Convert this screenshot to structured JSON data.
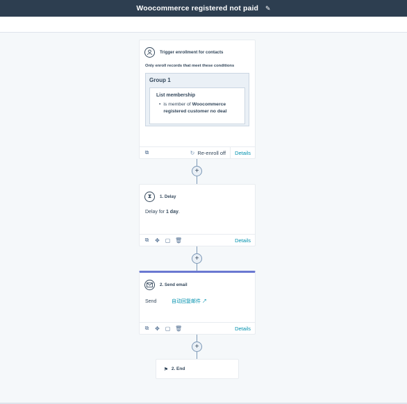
{
  "header": {
    "title": "Woocommerce registered not paid"
  },
  "trigger": {
    "title": "Trigger enrollment for contacts",
    "conditions_label": "Only enroll records that meet these conditions",
    "group_title": "Group 1",
    "list_title": "List membership",
    "condition_prefix": "is member of",
    "condition_value": "Woocommerce registered customer no deal",
    "reenroll_label": "Re-enroll off",
    "details_label": "Details"
  },
  "delay": {
    "title": "1. Delay",
    "text_prefix": "Delay for",
    "duration": "1 day",
    "text_suffix": ".",
    "details_label": "Details"
  },
  "email": {
    "title": "2. Send email",
    "send_label": "Send",
    "email_name": "自动回复邮件",
    "details_label": "Details"
  },
  "end": {
    "title": "2. End"
  },
  "colors": {
    "header_bg": "#2d3e50",
    "link": "#0091ae",
    "email_accent": "#6a78d1"
  }
}
